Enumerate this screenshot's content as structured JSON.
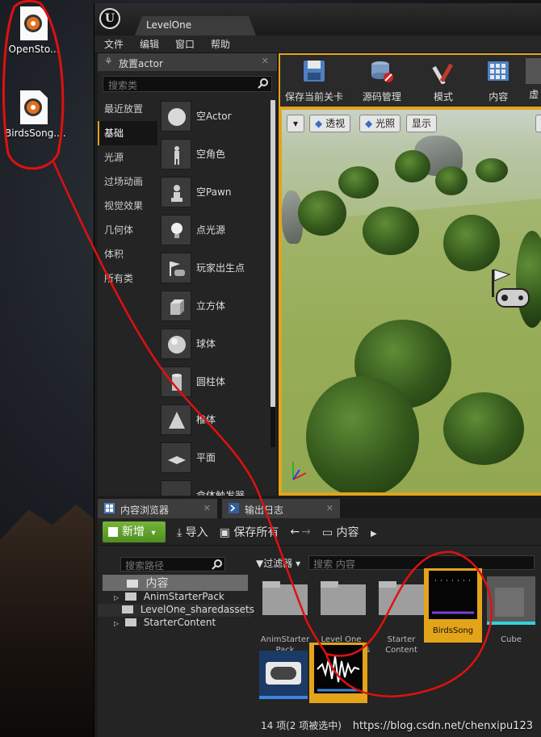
{
  "desktop": {
    "icons": [
      {
        "label": "OpenSto...",
        "icon": "audio-file-icon"
      },
      {
        "label": "BirdsSong....",
        "icon": "audio-file-icon"
      }
    ]
  },
  "window": {
    "level_tab": "LevelOne",
    "menu": [
      "文件",
      "编辑",
      "窗口",
      "帮助"
    ]
  },
  "place_panel": {
    "tab_label": "放置actor",
    "search_placeholder": "搜索类",
    "categories": [
      "最近放置",
      "基础",
      "光源",
      "过场动画",
      "视觉效果",
      "几何体",
      "体积",
      "所有类"
    ],
    "active_category": "基础",
    "items": [
      "空Actor",
      "空角色",
      "空Pawn",
      "点光源",
      "玩家出生点",
      "立方体",
      "球体",
      "圆柱体",
      "椎体",
      "平面",
      "盒体触发器"
    ]
  },
  "toolbar": {
    "buttons": [
      "保存当前关卡",
      "源码管理",
      "模式",
      "内容",
      "虚"
    ]
  },
  "viewport": {
    "perspective_label": "透视",
    "lighting_label": "光照",
    "show_label": "显示"
  },
  "content_browser": {
    "tab_label": "内容浏览器",
    "log_tab_label": "输出日志",
    "new_label": "新增",
    "import_label": "导入",
    "save_all_label": "保存所有",
    "path_label": "内容",
    "path_search_placeholder": "搜索路径",
    "filter_label": "过滤器",
    "content_search_placeholder": "搜索 内容",
    "tree": {
      "root": "内容",
      "children": [
        "AnimStarterPack",
        "LevelOne_sharedassets",
        "StarterContent"
      ]
    },
    "assets": [
      {
        "name": "AnimStarter Pack",
        "kind": "folder"
      },
      {
        "name": "Level One_ sharedassets",
        "kind": "folder"
      },
      {
        "name": "Starter Content",
        "kind": "folder"
      },
      {
        "name": "BirdsSong",
        "kind": "sound-wave",
        "selected": true
      },
      {
        "name": "Cube",
        "kind": "mesh"
      }
    ],
    "status": "14 项(2 项被选中)"
  },
  "watermark": "https://blog.csdn.net/chenxipu123",
  "colors": {
    "accent": "#e3a41a",
    "new_button": "#5a9e25",
    "annotation": "#e01010"
  }
}
